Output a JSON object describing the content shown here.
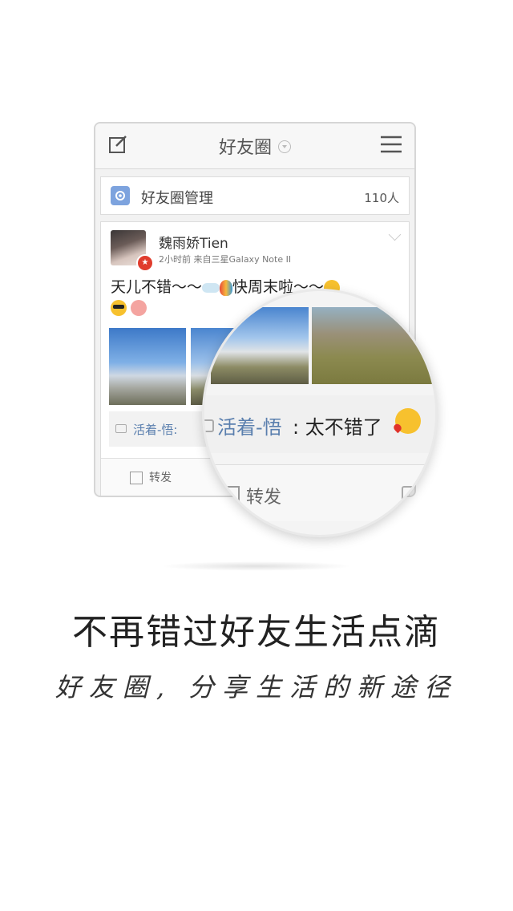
{
  "topbar": {
    "title": "好友圈"
  },
  "management": {
    "label": "好友圈管理",
    "count": "110人"
  },
  "post": {
    "username": "魏雨娇Tien",
    "meta": "2小时前  来自三星Galaxy Note II",
    "text_part1": "天儿不错～～",
    "text_part2": "快周末啦～～",
    "comment_author": "活着-悟:",
    "forward_label": "转发"
  },
  "magnifier": {
    "comment_author": "活着-悟",
    "comment_text": ": 太不错了",
    "forward_label": "转发"
  },
  "headline": "不再错过好友生活点滴",
  "subline": "好友圈, 分享生活的新途径",
  "colors": {
    "link": "#5a7fae",
    "gear_bg": "#7da3de",
    "badge": "#e03c2d"
  }
}
